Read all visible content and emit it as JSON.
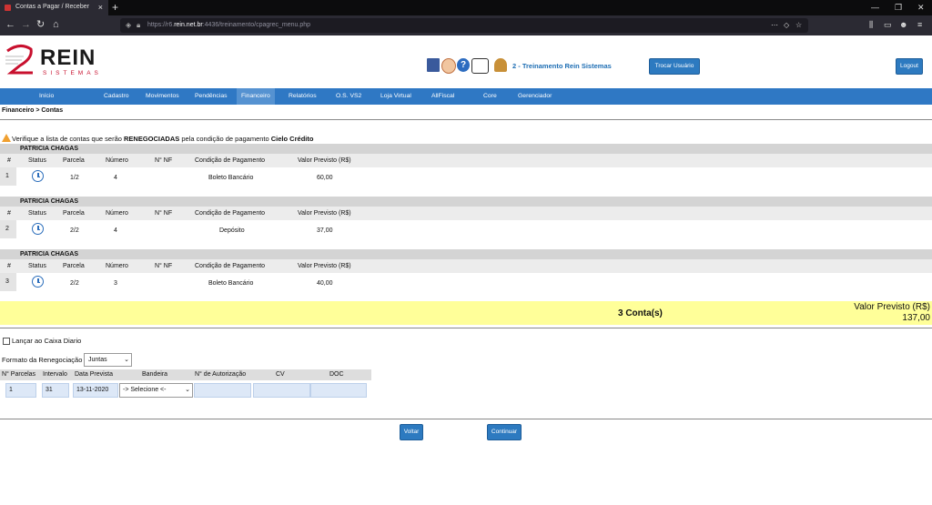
{
  "browser": {
    "tab_title": "Contas a Pagar / Receber",
    "url_prefix": "https://r6.",
    "url_domain": "rein.net.br",
    "url_suffix": ":4436/treinamento/cpagrec_menu.php",
    "page_actions": "⋯"
  },
  "header": {
    "brand": "REIN",
    "brand_sub": "SISTEMAS",
    "user_label": "2 - Treinamento Rein Sistemas",
    "switch_user": "Trocar Usuário",
    "logout": "Logout"
  },
  "menu": [
    "Início",
    "Cadastro",
    "Movimentos",
    "Pendências",
    "Financeiro",
    "Relatórios",
    "O.S. VS2",
    "Loja Virtual",
    "AllFiscal",
    "Core",
    "Gerenciador"
  ],
  "breadcrumb": "Financeiro > Contas",
  "warning": {
    "pre": "Verifique a lista de contas que serão ",
    "bold1": "RENEGOCIADAS",
    "mid": " pela condição de pagamento ",
    "bold2": "Cielo Crédito"
  },
  "columns": {
    "hash": "#",
    "status": "Status",
    "parcela": "Parcela",
    "numero": "Número",
    "nf": "N° NF",
    "condicao": "Condição de Pagamento",
    "valor": "Valor Previsto (R$)"
  },
  "groups": [
    {
      "name": "PATRICIA CHAGAS",
      "idx": "1",
      "parcela": "1/2",
      "numero": "4",
      "nf": "",
      "condicao": "Boleto Bancário",
      "valor": "60,00"
    },
    {
      "name": "PATRICIA CHAGAS",
      "idx": "2",
      "parcela": "2/2",
      "numero": "4",
      "nf": "",
      "condicao": "Depósito",
      "valor": "37,00"
    },
    {
      "name": "PATRICIA CHAGAS",
      "idx": "3",
      "parcela": "2/2",
      "numero": "3",
      "nf": "",
      "condicao": "Boleto Bancário",
      "valor": "40,00"
    }
  ],
  "summary": {
    "count": "3 Conta(s)",
    "label": "Valor Previsto (R$)",
    "total": "137,00"
  },
  "form": {
    "caixa_label": "Lançar ao Caixa Diario",
    "formato_label": "Formato da Renegociação",
    "formato_value": "Juntas",
    "headers": [
      "N° Parcelas",
      "Intervalo",
      "Data Prevista",
      "Bandeira",
      "N° de Autorização",
      "CV",
      "DOC"
    ],
    "parcelas": "1",
    "intervalo": "31",
    "data": "13-11-2020",
    "bandeira": "-> Selecione <-",
    "autorizacao": "",
    "cv": "",
    "doc": ""
  },
  "actions": {
    "voltar": "Voltar",
    "continuar": "Continuar"
  }
}
